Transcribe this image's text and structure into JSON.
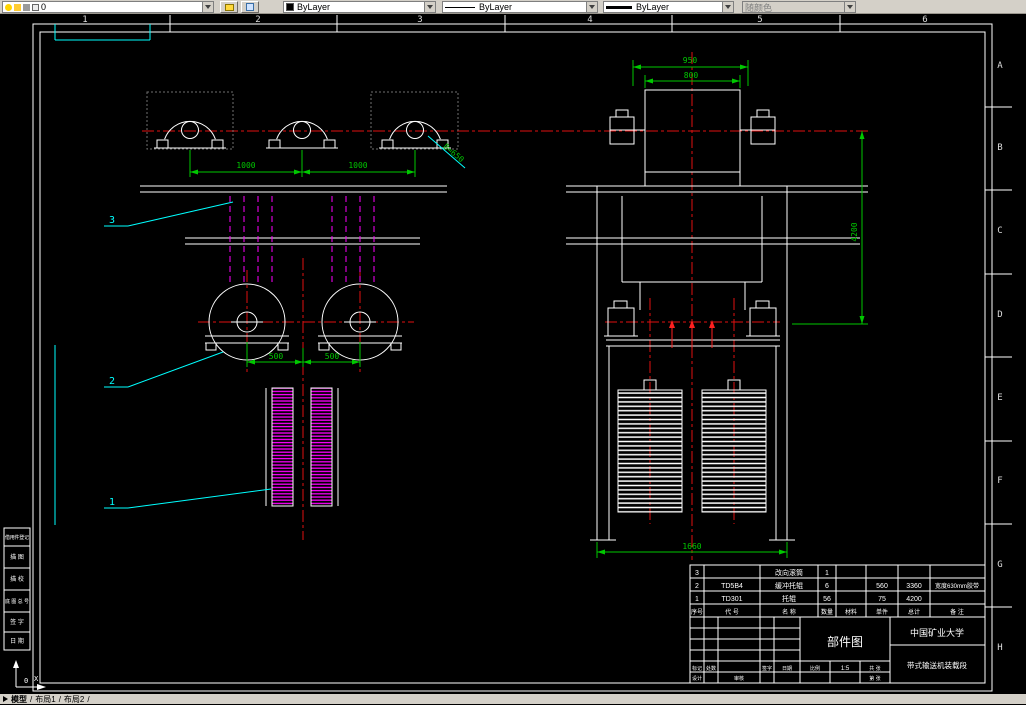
{
  "toolbar": {
    "layer_value": "0",
    "color_value": "ByLayer",
    "linetype_value": "ByLayer",
    "lineweight_value": "ByLayer",
    "plotstyle_value": "随颜色"
  },
  "grid": {
    "cols": [
      "1",
      "2",
      "3",
      "4",
      "5",
      "6"
    ],
    "rows": [
      "A",
      "B",
      "C",
      "D",
      "E",
      "F",
      "G",
      "H"
    ]
  },
  "drawing": {
    "leaders": {
      "l1": "1",
      "l2": "2",
      "l3": "3"
    },
    "dims": {
      "span_left": "1000",
      "span_right": "1000",
      "wheel_left": "500",
      "wheel_right": "500",
      "drum_outer": "950",
      "drum_inner": "800",
      "height": "4200",
      "base": "1660",
      "angled": "B=650"
    },
    "ucs": {
      "origin": "0",
      "axis": "X"
    }
  },
  "left_strip": {
    "items": [
      "借用件登记",
      "描 图",
      "描 校",
      "底图总号",
      "签 字",
      "日 期"
    ]
  },
  "bom": {
    "headers": {
      "no": "序号",
      "code": "代 号",
      "name": "名 称",
      "qty": "数量",
      "material": "材料",
      "unit": "单件",
      "total": "总计",
      "note": "备 注"
    },
    "rows": [
      {
        "no": "3",
        "code": "",
        "name": "改向滚筒",
        "qty": "1",
        "unit": "",
        "total": "",
        "note": ""
      },
      {
        "no": "2",
        "code": "TD5B4",
        "name": "缓冲托辊",
        "qty": "6",
        "unit": "560",
        "total": "3360",
        "note": "宽度630mm胶带"
      },
      {
        "no": "1",
        "code": "TD301",
        "name": "托辊",
        "qty": "56",
        "unit": "75",
        "total": "4200",
        "note": ""
      }
    ]
  },
  "titleblock": {
    "type": "部件图",
    "org": "中国矿业大学",
    "project": "带式输送机装载段",
    "scale_label": "比例",
    "scale": "1:5",
    "sheet": "共 张",
    "sheet2": "第 张",
    "f_mark": "标记",
    "f_count": "处数",
    "f_sign": "签字",
    "f_date": "日期",
    "f_design": "设计",
    "f_check": "审核"
  },
  "tabs": {
    "model": "模型",
    "layout1": "布局1",
    "layout2": "布局2",
    "sep": "/"
  },
  "colors": {
    "accent_cyan": "#00ffff",
    "dim_green": "#00c800",
    "center_red": "#e01010",
    "hatch_magenta": "#ff00ff"
  }
}
